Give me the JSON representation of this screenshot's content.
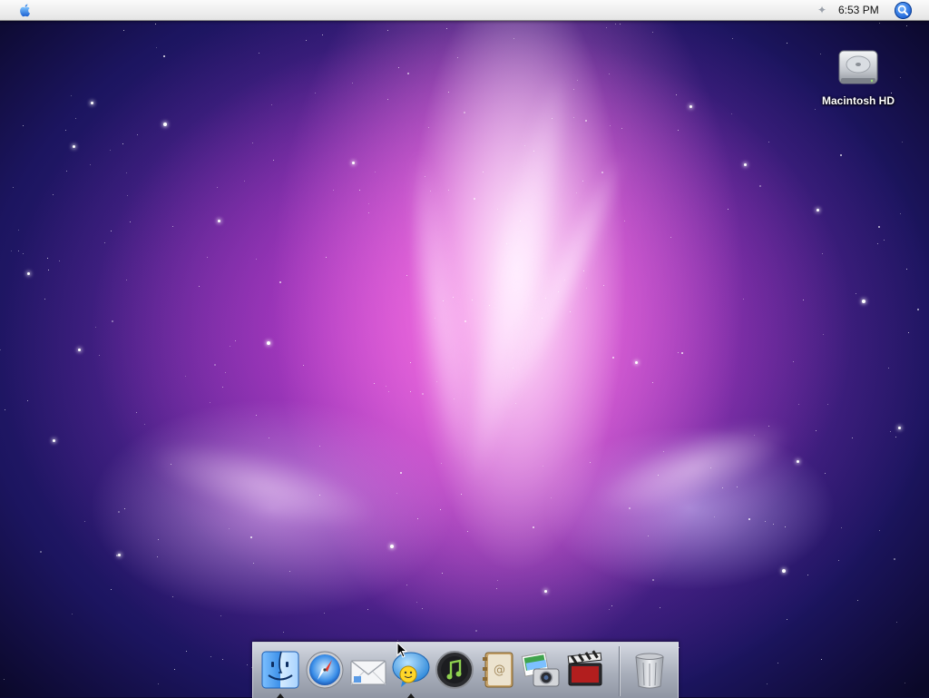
{
  "menubar": {
    "apple_menu_icon": "apple-logo",
    "spotlight_icon": "magnifier",
    "sparkle_glyph": "✦",
    "clock": "6:53 PM"
  },
  "desktop": {
    "wallpaper": "pink-purple aurora nebula",
    "icons": [
      {
        "label": "Macintosh HD",
        "icon": "hard-drive"
      }
    ]
  },
  "dock": {
    "apps": [
      {
        "icon": "finder",
        "running": true
      },
      {
        "icon": "safari-compass",
        "running": false
      },
      {
        "icon": "mail-envelope",
        "running": false
      },
      {
        "icon": "ichat-bubble",
        "running": true
      },
      {
        "icon": "itunes-music-note",
        "running": false
      },
      {
        "icon": "address-book",
        "running": false
      },
      {
        "icon": "iphoto-camera",
        "running": false
      },
      {
        "icon": "imovie-clapper",
        "running": false
      }
    ],
    "trash": {
      "icon": "trash-can"
    }
  },
  "colors": {
    "menubar_top": "#fbfbfb",
    "menubar_bottom": "#e4e4e4",
    "spotlight_blue": "#1c63d6",
    "wallpaper_core": "#ff82e6",
    "wallpaper_edge": "#0a0828"
  }
}
